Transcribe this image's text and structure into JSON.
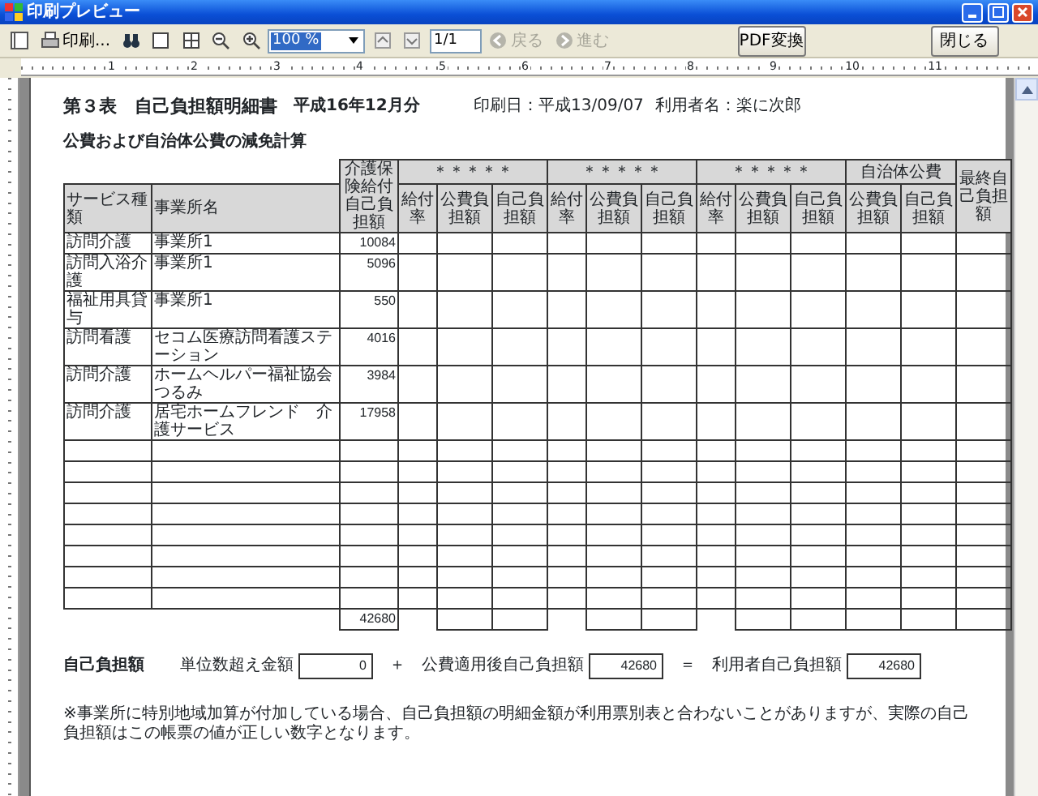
{
  "window": {
    "title": "印刷プレビュー"
  },
  "toolbar": {
    "print_label": "印刷...",
    "zoom": "100 %",
    "page": "1/1",
    "nav": [
      {
        "label": "戻る",
        "disabled": true
      },
      {
        "label": "進む",
        "disabled": true
      }
    ],
    "buttons": [
      "PDF変換",
      "閉じる"
    ]
  },
  "ruler": [
    "1",
    "2",
    "3",
    "4",
    "5",
    "6",
    "7",
    "8",
    "9",
    "10",
    "11"
  ],
  "report": {
    "title": "第３表　自己負担額明細書",
    "period": "平成16年12月分",
    "print_date": "印刷日：平成13/09/07",
    "user": "利用者名：楽に次郎",
    "subtitle": "公費および自治体公費の減免計算",
    "table": {
      "left_columns": [
        "サービス種類",
        "事業所名"
      ],
      "amount_column": "介護保険給付自己負担額",
      "groups": [
        {
          "label": "＊＊＊＊＊",
          "columns": [
            "給付率",
            "公費負担額",
            "自己負担額"
          ]
        },
        {
          "label": "＊＊＊＊＊",
          "columns": [
            "給付率",
            "公費負担額",
            "自己負担額"
          ]
        },
        {
          "label": "＊＊＊＊＊",
          "columns": [
            "給付率",
            "公費負担額",
            "自己負担額"
          ]
        },
        {
          "label": "自治体公費",
          "columns": [
            "公費負担額",
            "自己負担額"
          ]
        }
      ],
      "final_column": "最終自己負担額",
      "rows": [
        {
          "service": "訪問介護",
          "office": "事業所1",
          "amount": "10084"
        },
        {
          "service": "訪問入浴介護",
          "office": "事業所1",
          "amount": "5096"
        },
        {
          "service": "福祉用具貸与",
          "office": "事業所1",
          "amount": "550"
        },
        {
          "service": "訪問看護",
          "office": "セコム医療訪問看護ステーション",
          "amount": "4016"
        },
        {
          "service": "訪問介護",
          "office": "ホームヘルパー福祉協会つるみ",
          "amount": "3984"
        },
        {
          "service": "訪問介護",
          "office": "居宅ホームフレンド　介護サービス",
          "amount": "17958"
        }
      ],
      "total": "42680"
    },
    "summary": {
      "label": "自己負担額",
      "terms": [
        {
          "label": "単位数超え金額",
          "value": "0"
        },
        {
          "label": "公費適用後自己負担額",
          "value": "42680"
        },
        {
          "label": "利用者自己負担額",
          "value": "42680"
        }
      ],
      "operators": [
        "＋",
        "＝"
      ]
    },
    "footnote": "※事業所に特別地域加算が付加している場合、自己負担額の明細金額が利用票別表と合わないことがありますが、実際の自己負担額はこの帳票の値が正しい数字となります。"
  }
}
